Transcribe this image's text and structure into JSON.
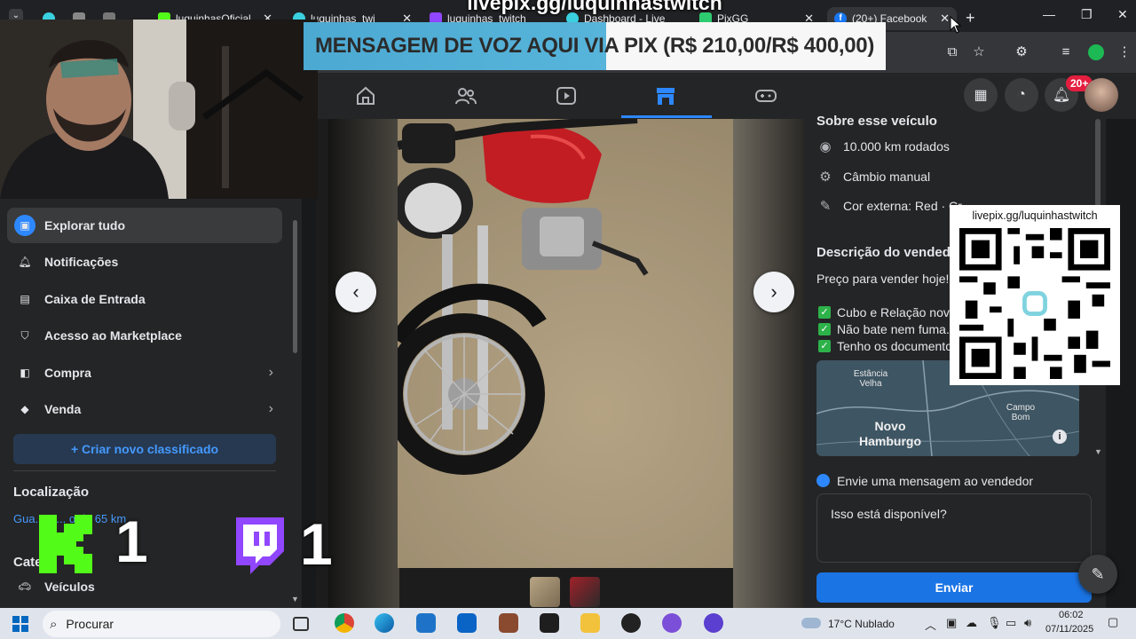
{
  "browser": {
    "tabs": [
      {
        "label": ""
      },
      {
        "label": "luquinhasOficial"
      },
      {
        "label": "luquinhas_twi"
      },
      {
        "label": "luquinhas_twitch"
      },
      {
        "label": "Dashboard - Live"
      },
      {
        "label": "PixGG"
      },
      {
        "label": "(20+) Facebook"
      }
    ]
  },
  "overlay": {
    "livepix_url": "livepix.gg/luquinhastwitch",
    "banner_text": "MENSAGEM DE VOZ AQUI VIA PIX (R$ 210,00/R$ 400,00)",
    "qr_url": "livepix.gg/luquinhastwitch",
    "kick_count": "1",
    "twitch_count": "1"
  },
  "nav": {
    "notifications_badge": "20+"
  },
  "sidebar": {
    "items": [
      {
        "label": "Explorar tudo",
        "icon": "storefront-icon"
      },
      {
        "label": "Notificações",
        "icon": "bell-icon"
      },
      {
        "label": "Caixa de Entrada",
        "icon": "inbox-icon"
      },
      {
        "label": "Acesso ao Marketplace",
        "icon": "shield-icon"
      },
      {
        "label": "Compra",
        "icon": "bag-icon"
      },
      {
        "label": "Venda",
        "icon": "tag-icon"
      }
    ],
    "create_label": "+ Criar novo classificado",
    "location_heading": "Localização",
    "location_value": "Gua... N... o de 65 km",
    "categories_heading": "Cate...",
    "category_vehicles": "Veículos"
  },
  "details": {
    "section_title": "Sobre esse veículo",
    "mileage": "10.000 km rodados",
    "transmission": "Câmbio manual",
    "exterior_color": "Cor externa: Red · Cr...",
    "description_title": "Descrição do vendedo...",
    "description_intro": "Preço para vender hoje!",
    "checks": [
      "Cubo e Relação nove...",
      "Não bate nem fuma...",
      "Tenho os documento..."
    ],
    "map_labels": {
      "estancia_velha": "Estância Velha",
      "novo_hamburgo": "Novo Hamburgo",
      "campo_bom": "Campo Bom"
    }
  },
  "message": {
    "heading": "Envie uma mensagem ao vendedor",
    "input_value": "Isso está disponível?",
    "send_label": "Enviar"
  },
  "taskbar": {
    "search_placeholder": "Procurar",
    "weather": "17°C  Nublado",
    "time": "06:02",
    "date": "07/11/2025"
  },
  "colors": {
    "fb_blue": "#1b74e4",
    "active_nav": "#2d88ff",
    "badge_red": "#e41e3f",
    "kick_green": "#53fc18",
    "twitch_purple": "#9146ff"
  }
}
